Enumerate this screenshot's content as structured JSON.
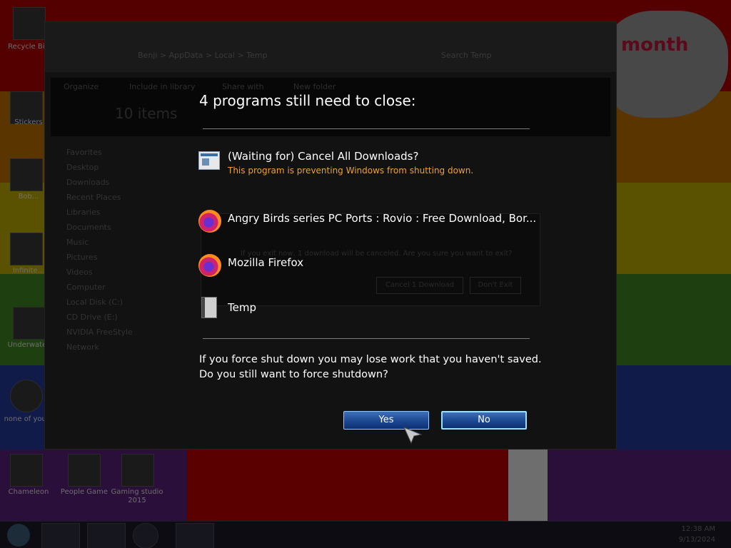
{
  "desktop": {
    "decoration_text": "month",
    "icons": [
      {
        "label": "Recycle Bin"
      },
      {
        "label": "Stickers"
      },
      {
        "label": "Bob..."
      },
      {
        "label": "Infinite..."
      },
      {
        "label": "Underwater"
      },
      {
        "label": "none of you..."
      },
      {
        "label": "Chameleon"
      },
      {
        "label": "People Game"
      },
      {
        "label": "Gaming studio 2015"
      }
    ]
  },
  "explorer": {
    "address": "Benji > AppData > Local > Temp",
    "search_placeholder": "Search Temp",
    "toolbar": [
      "Organize",
      "Include in library",
      "Share with",
      "New folder"
    ],
    "item_count": "10 items",
    "nav": [
      "Favorites",
      "Desktop",
      "Downloads",
      "Recent Places",
      "Libraries",
      "Documents",
      "Music",
      "Pictures",
      "Videos",
      "Computer",
      "Local Disk (C:)",
      "CD Drive (E:)",
      "NVIDIA FreeStyle",
      "Network"
    ],
    "inner_dialog": {
      "message": "If you exit now, 1 download will be canceled. Are you sure you want to exit?",
      "cancel_btn": "Cancel 1 Download",
      "dont_exit_btn": "Don't Exit"
    }
  },
  "taskbar": {
    "time": "12:38 AM",
    "date": "9/13/2024"
  },
  "shutdown": {
    "heading": "4 programs still need to close:",
    "apps": [
      {
        "name": "(Waiting for) Cancel All Downloads?",
        "warning": "This program is preventing Windows from shutting down.",
        "icon": "window-icon"
      },
      {
        "name": "Angry Birds series PC Ports : Rovio : Free Download, Bor...",
        "warning": "",
        "icon": "firefox-icon"
      },
      {
        "name": "Mozilla Firefox",
        "warning": "",
        "icon": "firefox-icon"
      },
      {
        "name": "Temp",
        "warning": "",
        "icon": "folder-icon"
      }
    ],
    "message_line1": "If you force shut down you may lose work that you haven't saved.",
    "message_line2": "Do you still want to force shutdown?",
    "yes_label": "Yes",
    "no_label": "No",
    "colors": {
      "warning": "#f0a030",
      "button_border": "#8fc7ff"
    }
  }
}
